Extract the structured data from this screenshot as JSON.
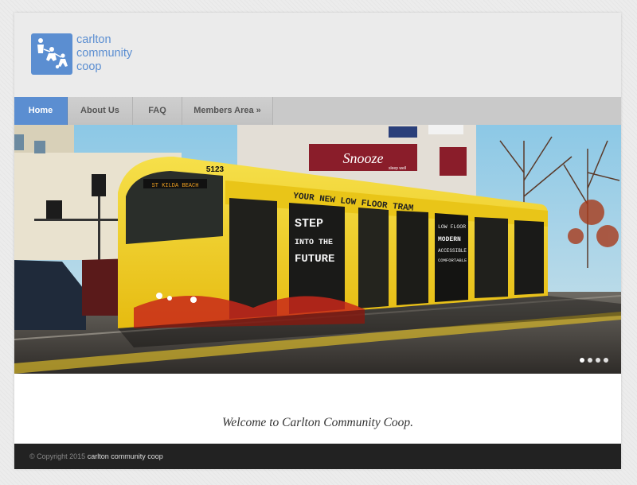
{
  "site": {
    "logo_lines": [
      "carlton",
      "community",
      "coop"
    ]
  },
  "nav": {
    "items": [
      {
        "label": "Home",
        "active": true
      },
      {
        "label": "About Us",
        "active": false
      },
      {
        "label": "FAQ",
        "active": false
      },
      {
        "label": "Members Area »",
        "active": false
      }
    ]
  },
  "hero": {
    "tram_number": "5123",
    "destination_sign": "ST KILDA BEACH",
    "tram_slogan_1": "STEP",
    "tram_slogan_2": "INTO THE",
    "tram_slogan_3": "FUTURE",
    "tram_side_text": "YOUR NEW LOW FLOOR TRAM",
    "tram_panel_2": [
      "LOW FLOOR",
      "MODERN",
      "ACCESSIBLE",
      "COMFORTABLE"
    ],
    "store_sign": "Snooze",
    "store_tagline": "sleep well",
    "slide_count": 4,
    "active_slide": 0
  },
  "welcome": {
    "text": "Welcome to Carlton Community Coop."
  },
  "footer": {
    "copyright": "© Copyright 2015",
    "brand": "carlton community coop"
  },
  "colors": {
    "accent": "#5b8ed1",
    "nav_bg": "#c9c9c9",
    "footer_bg": "#222222",
    "tram_yellow": "#f2d21b"
  }
}
